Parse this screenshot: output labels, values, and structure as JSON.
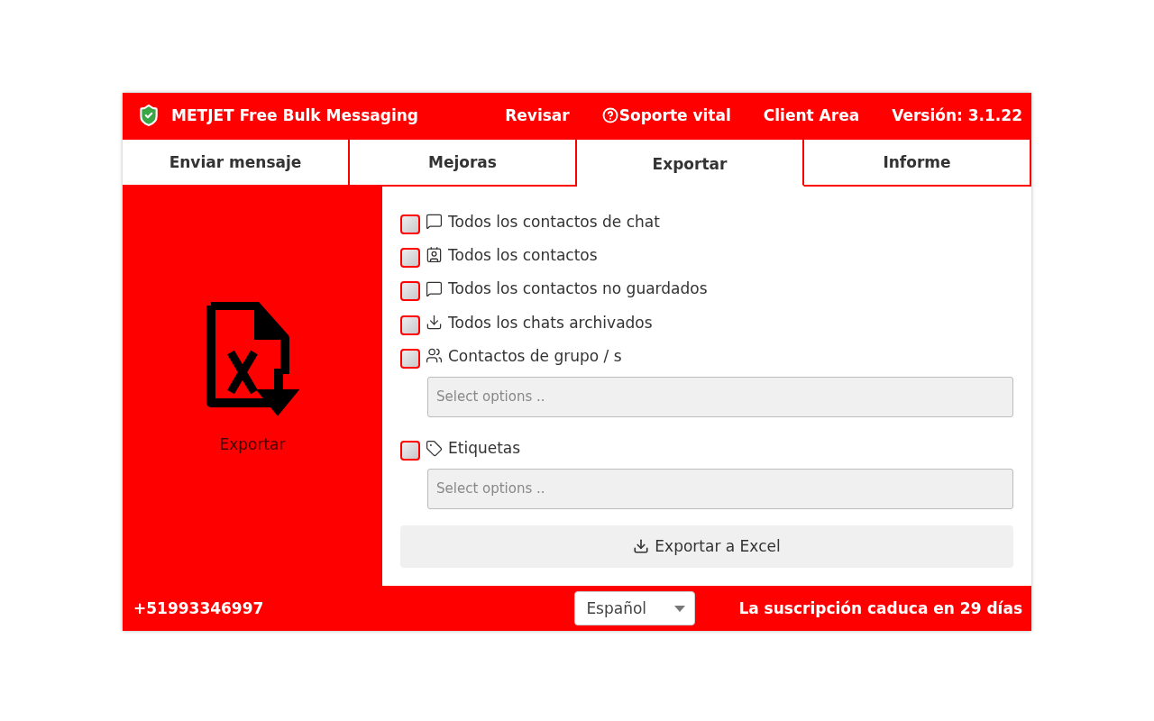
{
  "header": {
    "title": "METJET Free Bulk Messaging",
    "links": [
      {
        "label": "Revisar",
        "kind": "plain"
      },
      {
        "label": "Soporte vital",
        "kind": "help"
      },
      {
        "label": "Client Area",
        "kind": "plain"
      },
      {
        "label": "Versión: 3.1.22",
        "kind": "plain"
      }
    ]
  },
  "tabs": [
    {
      "label": "Enviar mensaje",
      "selected": false
    },
    {
      "label": "Mejoras",
      "selected": false
    },
    {
      "label": "Exportar",
      "selected": true
    },
    {
      "label": "Informe",
      "selected": false
    }
  ],
  "side_panel": {
    "label": "Exportar"
  },
  "options": [
    {
      "label": "Todos los contactos de chat",
      "kind": "chat",
      "checked": false
    },
    {
      "label": "Todos los contactos",
      "kind": "contact",
      "checked": false
    },
    {
      "label": "Todos los contactos no guardados",
      "kind": "chat",
      "checked": false
    },
    {
      "label": "Todos los chats archivados",
      "kind": "download",
      "checked": false
    },
    {
      "label": "Contactos de grupo / s",
      "kind": "group",
      "checked": false,
      "select": {
        "placeholder": "Select options .."
      }
    },
    {
      "label": "Etiquetas",
      "kind": "tag",
      "checked": false,
      "select": {
        "placeholder": "Select options .."
      }
    }
  ],
  "export_button": {
    "label": "Exportar a Excel"
  },
  "footer": {
    "phone": "+51993346997",
    "language": "Español",
    "subscription": "La suscripción caduca en 29 días"
  }
}
